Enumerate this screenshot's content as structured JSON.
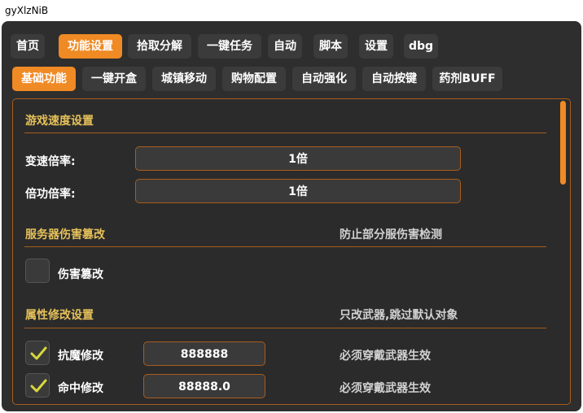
{
  "window": {
    "title": "gyXlzNiB"
  },
  "main_tabs": [
    {
      "label": "首页",
      "active": false
    },
    {
      "label": "功能设置",
      "active": true
    },
    {
      "label": "拾取分解",
      "active": false
    },
    {
      "label": "一键任务",
      "active": false
    },
    {
      "label": "自动",
      "active": false
    },
    {
      "label": "脚本",
      "active": false
    },
    {
      "label": "设置",
      "active": false
    },
    {
      "label": "dbg",
      "active": false
    }
  ],
  "sub_tabs": [
    {
      "label": "基础功能",
      "active": true
    },
    {
      "label": "一键开盒",
      "active": false
    },
    {
      "label": "城镇移动",
      "active": false
    },
    {
      "label": "购物配置",
      "active": false
    },
    {
      "label": "自动强化",
      "active": false
    },
    {
      "label": "自动按键",
      "active": false
    },
    {
      "label": "药剂BUFF",
      "active": false
    }
  ],
  "speed": {
    "title": "游戏速度设置",
    "rate_label": "变速倍率:",
    "rate_value": "1倍",
    "skill_label": "倍功倍率:",
    "skill_value": "1倍"
  },
  "damage": {
    "title": "服务器伤害篡改",
    "note": "防止部分服伤害检测",
    "checkbox_label": "伤害篡改",
    "checked": false
  },
  "attr": {
    "title": "属性修改设置",
    "note": "只改武器,跳过默认对象",
    "rows": [
      {
        "label": "抗魔修改",
        "value": "888888",
        "checked": true,
        "note": "必须穿戴武器生效"
      },
      {
        "label": "命中修改",
        "value": "88888.0",
        "checked": true,
        "note": "必须穿戴武器生效"
      }
    ]
  },
  "colors": {
    "accent": "#f08a24",
    "section_title": "#e6c15a",
    "background": "#2e2e2e",
    "check": "#d8d63a"
  }
}
